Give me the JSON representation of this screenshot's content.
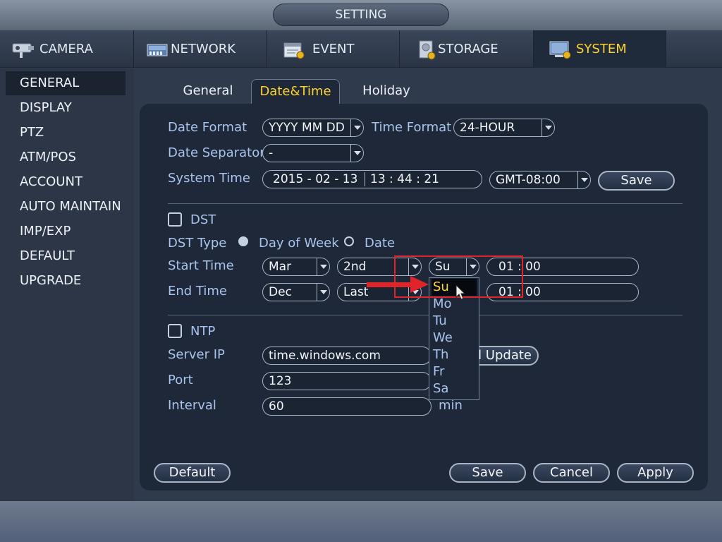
{
  "window": {
    "title": "SETTING"
  },
  "tabs": [
    {
      "label": "CAMERA",
      "icon": "camera-icon"
    },
    {
      "label": "NETWORK",
      "icon": "network-icon"
    },
    {
      "label": "EVENT",
      "icon": "event-icon"
    },
    {
      "label": "STORAGE",
      "icon": "storage-icon"
    },
    {
      "label": "SYSTEM",
      "icon": "system-icon",
      "active": true
    }
  ],
  "sidebar": {
    "items": [
      {
        "label": "GENERAL",
        "active": true
      },
      {
        "label": "DISPLAY"
      },
      {
        "label": "PTZ"
      },
      {
        "label": "ATM/POS"
      },
      {
        "label": "ACCOUNT"
      },
      {
        "label": "AUTO MAINTAIN"
      },
      {
        "label": "IMP/EXP"
      },
      {
        "label": "DEFAULT"
      },
      {
        "label": "UPGRADE"
      }
    ]
  },
  "subtabs": [
    {
      "label": "General"
    },
    {
      "label": "Date&Time",
      "active": true
    },
    {
      "label": "Holiday"
    }
  ],
  "form": {
    "date_format_label": "Date Format",
    "date_format_value": "YYYY MM DD",
    "time_format_label": "Time Format",
    "time_format_value": "24-HOUR",
    "date_separator_label": "Date Separator",
    "date_separator_value": "-",
    "system_time_label": "System Time",
    "system_date_value": "2015 - 02 - 13",
    "system_clock_value": "13 :  44 :  21",
    "timezone_value": "GMT-08:00",
    "save_time_label": "Save",
    "dst_label": "DST",
    "dst_checked": false,
    "dst_type_label": "DST Type",
    "dst_type_option1": "Day of Week",
    "dst_type_option2": "Date",
    "dst_type_selected": "Day of Week",
    "start_time_label": "Start Time",
    "start_month": "Mar",
    "start_week": "2nd",
    "start_day": "Su",
    "start_clock": "01 :    00",
    "end_time_label": "End Time",
    "end_month": "Dec",
    "end_week": "Last",
    "end_clock": "01 :    00",
    "ntp_label": "NTP",
    "ntp_checked": false,
    "server_ip_label": "Server IP",
    "server_ip_value": "time.windows.com",
    "manual_update_label": "al Update",
    "port_label": "Port",
    "port_value": "123",
    "interval_label": "Interval",
    "interval_value": "60",
    "interval_unit": "min"
  },
  "day_dropdown": {
    "options": [
      "Su",
      "Mo",
      "Tu",
      "We",
      "Th",
      "Fr",
      "Sa"
    ],
    "selected": "Su"
  },
  "footer_buttons": {
    "default": "Default",
    "save": "Save",
    "cancel": "Cancel",
    "apply": "Apply"
  },
  "colors": {
    "accent": "#ffd42a",
    "label": "#a9c3ec",
    "annotation": "#e0252a"
  }
}
